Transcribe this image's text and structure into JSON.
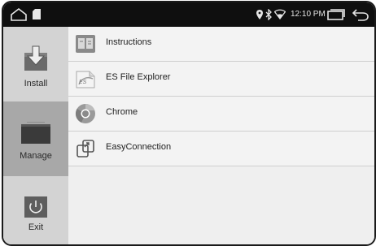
{
  "statusbar": {
    "home_icon": "home-icon",
    "sd_icon": "sd-card-icon",
    "time": "12:10 PM",
    "location_icon": "location-icon",
    "bluetooth_icon": "bluetooth-icon",
    "wifi_icon": "wifi-icon",
    "recents_icon": "recent-apps-icon",
    "back_icon": "back-icon"
  },
  "sidebar": {
    "items": [
      {
        "label": "Install",
        "icon": "download-arrow-icon"
      },
      {
        "label": "Manage",
        "icon": "manage-screen-icon",
        "selected": true
      },
      {
        "label": "Exit",
        "icon": "power-icon"
      }
    ]
  },
  "apps": [
    {
      "label": "Instructions",
      "icon": "instructions-icon"
    },
    {
      "label": "ES File Explorer",
      "icon": "es-file-explorer-icon"
    },
    {
      "label": "Chrome",
      "icon": "chrome-icon"
    },
    {
      "label": "EasyConnection",
      "icon": "easyconnection-icon"
    }
  ],
  "colors": {
    "statusbar_bg": "#0f0f0f",
    "sidebar_bg": "#d3d3d3",
    "selected_bg": "#a8a8a8",
    "list_bg": "#efefef"
  }
}
